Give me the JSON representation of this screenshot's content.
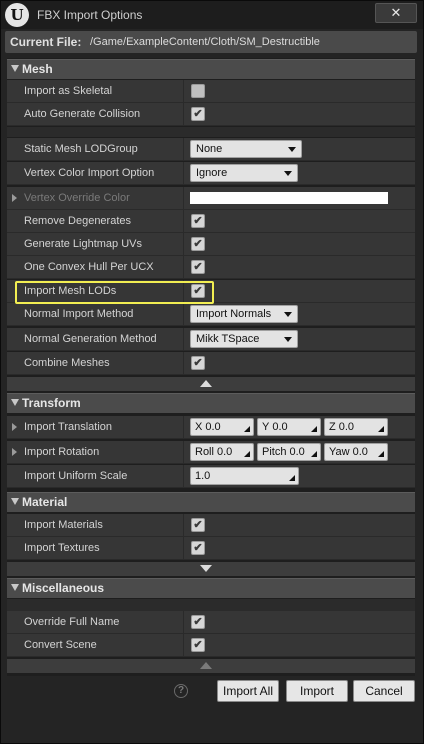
{
  "window": {
    "title": "FBX Import Options",
    "logo_text": "U",
    "close_glyph": "✕",
    "current_file_label": "Current File:",
    "current_file_value": "/Game/ExampleContent/Cloth/SM_Destructible"
  },
  "mesh": {
    "title": "Mesh",
    "import_as_skeletal": {
      "label": "Import as Skeletal",
      "checked": false
    },
    "auto_generate_collision": {
      "label": "Auto Generate Collision",
      "checked": true
    },
    "static_mesh_lodgroup": {
      "label": "Static Mesh LODGroup",
      "value": "None"
    },
    "vertex_color_import_option": {
      "label": "Vertex Color Import Option",
      "value": "Ignore"
    },
    "vertex_override_color": {
      "label": "Vertex Override Color",
      "value": "#ffffff"
    },
    "remove_degenerates": {
      "label": "Remove Degenerates",
      "checked": true
    },
    "generate_lightmap_uvs": {
      "label": "Generate Lightmap UVs",
      "checked": true
    },
    "one_convex_hull_per_ucx": {
      "label": "One Convex Hull Per UCX",
      "checked": true
    },
    "import_mesh_lods": {
      "label": "Import Mesh LODs",
      "checked": true
    },
    "normal_import_method": {
      "label": "Normal Import Method",
      "value": "Import Normals"
    },
    "normal_generation_method": {
      "label": "Normal Generation Method",
      "value": "Mikk TSpace"
    },
    "combine_meshes": {
      "label": "Combine Meshes",
      "checked": true
    }
  },
  "transform": {
    "title": "Transform",
    "import_translation": {
      "label": "Import Translation",
      "x_label": "X",
      "x": "0.0",
      "y_label": "Y",
      "y": "0.0",
      "z_label": "Z",
      "z": "0.0"
    },
    "import_rotation": {
      "label": "Import Rotation",
      "roll_label": "Roll",
      "roll": "0.0",
      "pitch_label": "Pitch",
      "pitch": "0.0",
      "yaw_label": "Yaw",
      "yaw": "0.0"
    },
    "import_uniform_scale": {
      "label": "Import Uniform Scale",
      "value": "1.0"
    }
  },
  "material": {
    "title": "Material",
    "import_materials": {
      "label": "Import Materials",
      "checked": true
    },
    "import_textures": {
      "label": "Import Textures",
      "checked": true
    }
  },
  "misc": {
    "title": "Miscellaneous",
    "override_full_name": {
      "label": "Override Full Name",
      "checked": true
    },
    "convert_scene": {
      "label": "Convert Scene",
      "checked": true
    }
  },
  "buttons": {
    "help": "?",
    "import_all": "Import All",
    "import": "Import",
    "cancel": "Cancel"
  },
  "colors": {
    "highlight": "#f2ee52",
    "category_header": "#4b4b4b",
    "row_bg": "#363636"
  }
}
